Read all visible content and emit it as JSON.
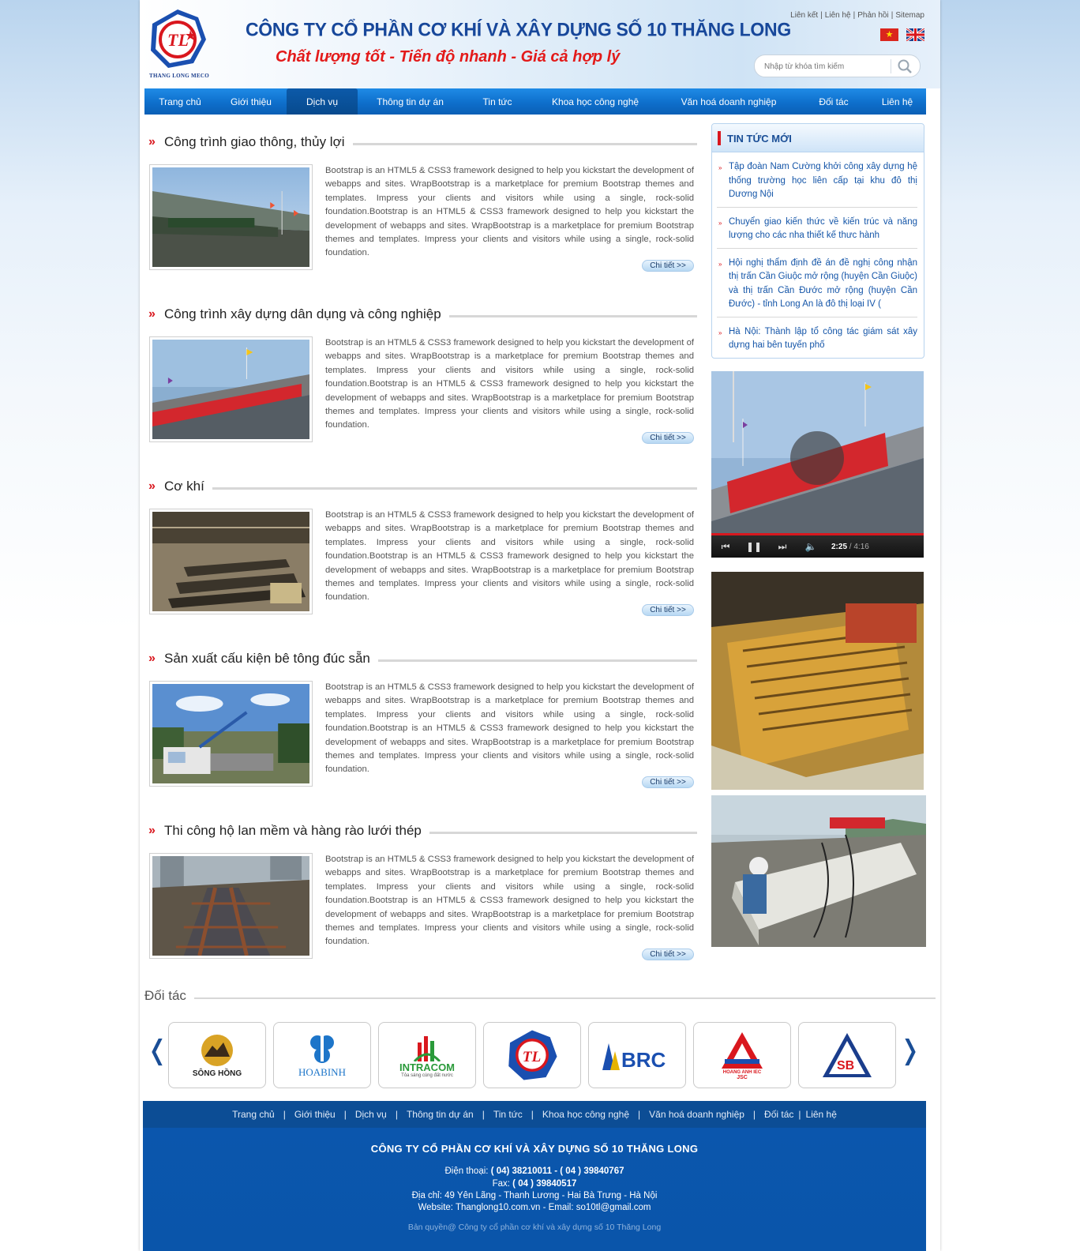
{
  "header": {
    "logo_caption": "THANG LONG MECO",
    "company_title": "CÔNG TY CỔ PHẦN CƠ KHÍ VÀ XÂY DỰNG SỐ 10 THĂNG LONG",
    "slogan": "Chất lượng tốt - Tiến độ nhanh - Giá cả hợp lý",
    "top_links": [
      "Liên kết",
      "Liên hệ",
      "Phản hồi",
      "Sitemap"
    ],
    "search_placeholder": "Nhập từ khóa tìm kiếm"
  },
  "nav": {
    "items": [
      "Trang chủ",
      "Giới thiệu",
      "Dịch vụ",
      "Thông tin dự án",
      "Tin tức",
      "Khoa học công nghệ",
      "Văn hoá doanh nghiệp",
      "Đối tác",
      "Liên hệ"
    ],
    "active": "Dịch vụ"
  },
  "sections": [
    {
      "title": "Công trình giao thông, thủy lợi",
      "body": "Bootstrap is an HTML5 & CSS3 framework designed to help you kickstart the development of webapps and sites. WrapBootstrap is a marketplace for premium Bootstrap themes and templates. Impress your clients and visitors while using a single, rock-solid foundation.Bootstrap is an HTML5 & CSS3 framework designed to help you kickstart the development of webapps and sites. WrapBootstrap is a marketplace for premium Bootstrap themes and templates. Impress your clients and visitors while using a single, rock-solid foundation.",
      "button": "Chi tiết >>"
    },
    {
      "title": "Công trình xây dựng dân dụng và công nghiệp",
      "body": "Bootstrap is an HTML5 & CSS3 framework designed to help you kickstart the development of webapps and sites. WrapBootstrap is a marketplace for premium Bootstrap themes and templates. Impress your clients and visitors while using a single, rock-solid foundation.Bootstrap is an HTML5 & CSS3 framework designed to help you kickstart the development of webapps and sites. WrapBootstrap is a marketplace for premium Bootstrap themes and templates. Impress your clients and visitors while using a single, rock-solid foundation.",
      "button": "Chi tiết >>"
    },
    {
      "title": "Cơ khí",
      "body": "Bootstrap is an HTML5 & CSS3 framework designed to help you kickstart the development of webapps and sites. WrapBootstrap is a marketplace for premium Bootstrap themes and templates. Impress your clients and visitors while using a single, rock-solid foundation.Bootstrap is an HTML5 & CSS3 framework designed to help you kickstart the development of webapps and sites. WrapBootstrap is a marketplace for premium Bootstrap themes and templates. Impress your clients and visitors while using a single, rock-solid foundation.",
      "button": "Chi tiết >>"
    },
    {
      "title": "Sản xuất cấu kiện bê tông đúc sẵn",
      "body": "Bootstrap is an HTML5 & CSS3 framework designed to help you kickstart the development of webapps and sites. WrapBootstrap is a marketplace for premium Bootstrap themes and templates. Impress your clients and visitors while using a single, rock-solid foundation.Bootstrap is an HTML5 & CSS3 framework designed to help you kickstart the development of webapps and sites. WrapBootstrap is a marketplace for premium Bootstrap themes and templates. Impress your clients and visitors while using a single, rock-solid foundation.",
      "button": "Chi tiết >>"
    },
    {
      "title": "Thi công hộ lan mềm và hàng rào lưới thép",
      "body": "Bootstrap is an HTML5 & CSS3 framework designed to help you kickstart the development of webapps and sites. WrapBootstrap is a marketplace for premium Bootstrap themes and templates. Impress your clients and visitors while using a single, rock-solid foundation.Bootstrap is an HTML5 & CSS3 framework designed to help you kickstart the development of webapps and sites. WrapBootstrap is a marketplace for premium Bootstrap themes and templates. Impress your clients and visitors while using a single, rock-solid foundation.",
      "button": "Chi tiết >>"
    }
  ],
  "sidebar": {
    "news_title": "TIN TỨC MỚI",
    "news": [
      "Tập đoàn Nam Cường khởi công xây dựng hệ thống trường học liên cấp tại khu đô thị Dương Nội",
      "Chuyển giao kiến thức về kiến trúc và năng lượng cho các nha thiết kế thưc hành",
      "Hội nghị thẩm định đề án đề nghị công nhận thị trấn Cần Giuộc mở rộng (huyện Cần Giuộc) và thị trấn Cần Đước mở rộng (huyện Cần Đước) - tỉnh Long An là đô thị loại IV (",
      "Hà Nội: Thành lập tổ công tác giám sát xây dựng hai bên tuyến phố"
    ],
    "video": {
      "current": "2:25",
      "duration": "/ 4:16",
      "progress": 0.566
    }
  },
  "partners": {
    "title": "Đối tác",
    "logos": [
      {
        "name": "song-hong-logo",
        "label": "SÔNG HỒNG"
      },
      {
        "name": "hoabinh-logo",
        "label": "HOABINH"
      },
      {
        "name": "intracom-logo",
        "label": "INTRACOM",
        "sub": "Tỏa sáng cùng đất nước"
      },
      {
        "name": "thang-long-logo",
        "label": "TL"
      },
      {
        "name": "brc-logo",
        "label": "BRC"
      },
      {
        "name": "hoang-anh-logo",
        "label": "HOANG ANH IEC",
        "sub": "JSC"
      },
      {
        "name": "sba-logo",
        "label": "SB"
      }
    ]
  },
  "footer": {
    "nav": [
      "Trang chủ",
      "Giới thiệu",
      "Dịch vụ",
      "Thông tin dự án",
      "Tin tức",
      "Khoa học công nghệ",
      "Văn hoá doanh nghiệp",
      "Đối tác",
      "Liên hệ"
    ],
    "company": "CÔNG TY CỔ PHẦN CƠ KHÍ VÀ XÂY DỰNG SỐ 10 THĂNG LONG",
    "phone_label": "Điện thoại: ",
    "phone": "( 04) 38210011 - ( 04 ) 39840767",
    "fax_label": "Fax: ",
    "fax": "( 04 ) 39840517",
    "address": "Địa chỉ: 49 Yên Lãng - Thanh Lương - Hai Bà Trưng - Hà Nội",
    "website": "Website: Thanglong10.com.vn - Email: so10tl@gmail.com",
    "copyright": "Bản quyền@ Công ty cổ phần cơ khí và xây dựng số 10 Thăng Long"
  },
  "colors": {
    "brand_blue": "#0e6fcc",
    "accent_red": "#d9171e",
    "footer_blue": "#0b56ad"
  }
}
